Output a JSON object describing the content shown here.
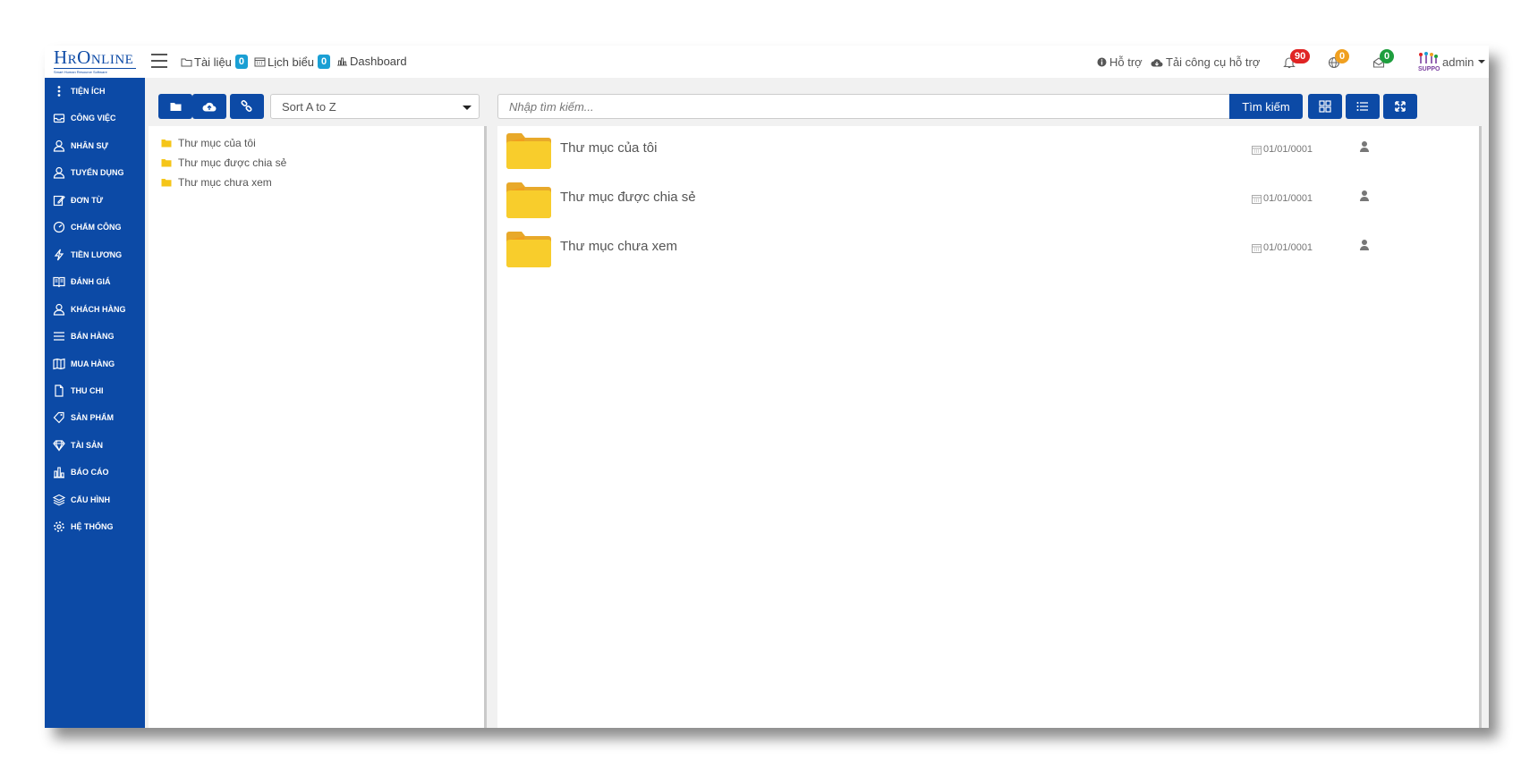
{
  "app": {
    "logo_text": "HrOnline",
    "logo_subtext": "Smart Human Resource Software"
  },
  "topnav": {
    "documents": {
      "label": "Tài liệu",
      "badge": "0"
    },
    "calendar": {
      "label": "Lịch biểu",
      "badge": "0"
    },
    "dashboard": {
      "label": "Dashboard"
    },
    "support": {
      "label": "Hỗ trợ"
    },
    "support_tool": {
      "label": "Tải công cụ hỗ trợ"
    },
    "notifications": {
      "count": "90",
      "color": "#e02424"
    },
    "globe": {
      "count": "0",
      "color": "#f0a020"
    },
    "messages": {
      "count": "0",
      "color": "#1e9e3e"
    },
    "user": {
      "name": "admin"
    }
  },
  "sidebar": {
    "items": [
      {
        "label": "TIỆN ÍCH",
        "icon": "dots-vertical-icon"
      },
      {
        "label": "CÔNG VIỆC",
        "icon": "inbox-icon"
      },
      {
        "label": "NHÂN SỰ",
        "icon": "user-icon"
      },
      {
        "label": "TUYỂN DỤNG",
        "icon": "user-icon"
      },
      {
        "label": "ĐƠN TỪ",
        "icon": "edit-icon"
      },
      {
        "label": "CHẤM CÔNG",
        "icon": "speedometer-icon"
      },
      {
        "label": "TIỀN LƯƠNG",
        "icon": "bolt-icon"
      },
      {
        "label": "ĐÁNH GIÁ",
        "icon": "book-icon"
      },
      {
        "label": "KHÁCH HÀNG",
        "icon": "user-icon"
      },
      {
        "label": "BÁN HÀNG",
        "icon": "menu-icon"
      },
      {
        "label": "MUA HÀNG",
        "icon": "map-icon"
      },
      {
        "label": "THU CHI",
        "icon": "file-icon"
      },
      {
        "label": "SẢN PHẨM",
        "icon": "tag-icon"
      },
      {
        "label": "TÀI SẢN",
        "icon": "diamond-icon"
      },
      {
        "label": "BÁO CÁO",
        "icon": "bar-chart-icon"
      },
      {
        "label": "CẤU HÌNH",
        "icon": "layers-icon"
      },
      {
        "label": "HỆ THỐNG",
        "icon": "gear-icon"
      }
    ]
  },
  "toolbar": {
    "sort_value": "Sort A to Z",
    "search_placeholder": "Nhập tìm kiếm...",
    "search_button": "Tìm kiếm"
  },
  "tree": {
    "items": [
      {
        "label": "Thư mục của tôi"
      },
      {
        "label": "Thư mục được chia sẻ"
      },
      {
        "label": "Thư mục chưa xem"
      }
    ]
  },
  "folders": {
    "rows": [
      {
        "name": "Thư mục của tôi",
        "date": "01/01/0001"
      },
      {
        "name": "Thư mục được chia sẻ",
        "date": "01/01/0001"
      },
      {
        "name": "Thư mục chưa xem",
        "date": "01/01/0001"
      }
    ]
  },
  "colors": {
    "brand": "#0c4aa6",
    "folder": "#f5c518",
    "badge_blue": "#1a9fd4"
  }
}
